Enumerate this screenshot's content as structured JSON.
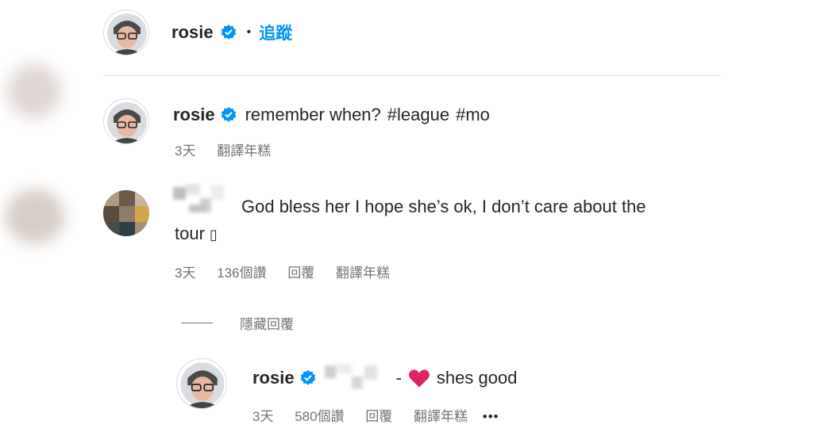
{
  "header": {
    "username": "rosie",
    "dot": "•",
    "follow_label": "追蹤"
  },
  "caption": {
    "username": "rosie",
    "text": "remember when?",
    "hashtags": [
      "#league",
      "#mo"
    ],
    "time": "3天",
    "translate": "翻譯年糕"
  },
  "comment": {
    "text_line1": "God bless her I hope she’s ok, I don’t care about the",
    "text_line2": "tour",
    "glyph": "▯",
    "time": "3天",
    "likes": "136個讚",
    "reply": "回覆",
    "translate": "翻譯年糕"
  },
  "replies_toggle": {
    "line": "——",
    "label": "隱藏回覆"
  },
  "reply": {
    "username": "rosie",
    "dash": "-",
    "text": "shes good",
    "time": "3天",
    "likes": "580個讚",
    "reply": "回覆",
    "translate": "翻譯年糕",
    "more": "•••"
  },
  "colors": {
    "verified": "#0095f6",
    "heart": "#e0245e",
    "link": "#00376b",
    "meta": "#737373"
  }
}
